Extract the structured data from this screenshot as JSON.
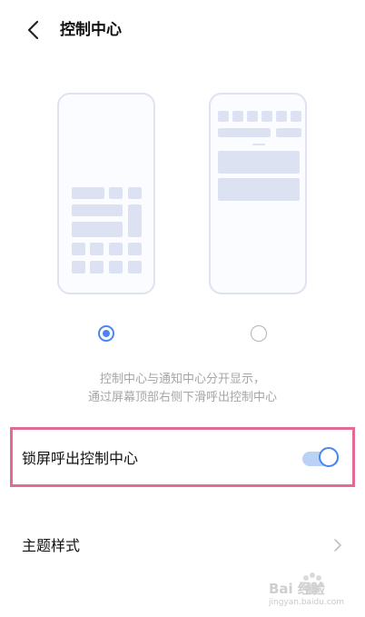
{
  "header": {
    "title": "控制中心",
    "back_icon": "chevron-left-icon"
  },
  "layout_options": [
    {
      "name": "combined-style",
      "selected": true
    },
    {
      "name": "separate-style",
      "selected": false
    }
  ],
  "description": {
    "line1": "控制中心与通知中心分开显示，",
    "line2": "通过屏幕顶部右侧下滑呼出控制中心"
  },
  "settings": {
    "lockscreen_label": "锁屏呼出控制中心",
    "lockscreen_enabled": true,
    "theme_label": "主题样式",
    "theme_icon": "chevron-right-icon"
  },
  "watermark": {
    "brand": "Bai  经验",
    "url": "jingyan.baidu.com"
  },
  "colors": {
    "accent": "#4a86f0",
    "toggle_track": "#b9d2f6",
    "highlight_border": "#e36a97",
    "preview_block": "#dde2f2"
  }
}
